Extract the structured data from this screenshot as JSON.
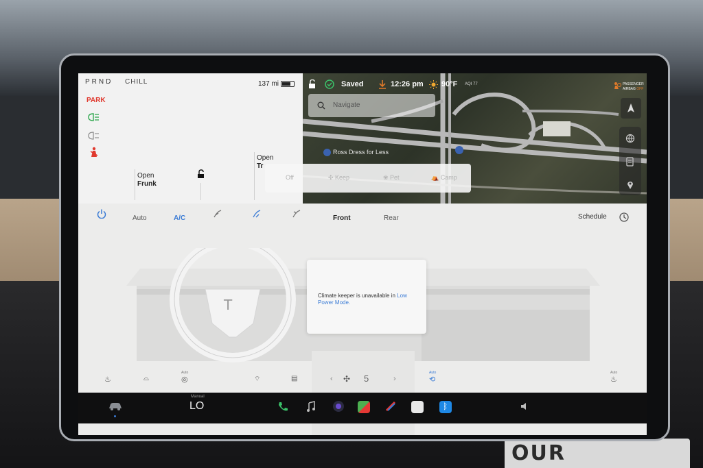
{
  "car_panel": {
    "gear": "PRND",
    "drive_mode": "CHILL",
    "range": "137 mi",
    "park_label": "PARK",
    "open_frunk_line1": "Open",
    "open_frunk_line2": "Frunk",
    "open_trunk_line1": "Open",
    "open_trunk_line2": "Tr"
  },
  "status": {
    "saved": "Saved",
    "time": "12:26 pm",
    "temperature": "90°F",
    "aqi": "AQI 77",
    "airbag_line1": "PASSENGER",
    "airbag_line2_prefix": "AIRBAG ",
    "airbag_line2_state": "OFF"
  },
  "map": {
    "search_placeholder": "Navigate",
    "poi_label": "Ross Dress for Less"
  },
  "climate_keeper_modes": [
    "Off",
    "Keep",
    "Pet",
    "Camp"
  ],
  "climate": {
    "auto": "Auto",
    "ac": "A/C",
    "front": "Front",
    "rear": "Rear",
    "schedule": "Schedule",
    "fan_speed": "5",
    "auto_small": "Auto",
    "keeper_message": "Climate keeper is unavailable in ",
    "keeper_link": "Low Power Mode."
  },
  "dock": {
    "temp_mode": "Manual",
    "temp_value": "LO"
  },
  "colors": {
    "accent_blue": "#3a7bd5",
    "park_red": "#e03a2f",
    "headlight_green": "#2fa84f",
    "status_orange": "#e07a2a"
  },
  "background_sign": "OUR BUSINESS"
}
